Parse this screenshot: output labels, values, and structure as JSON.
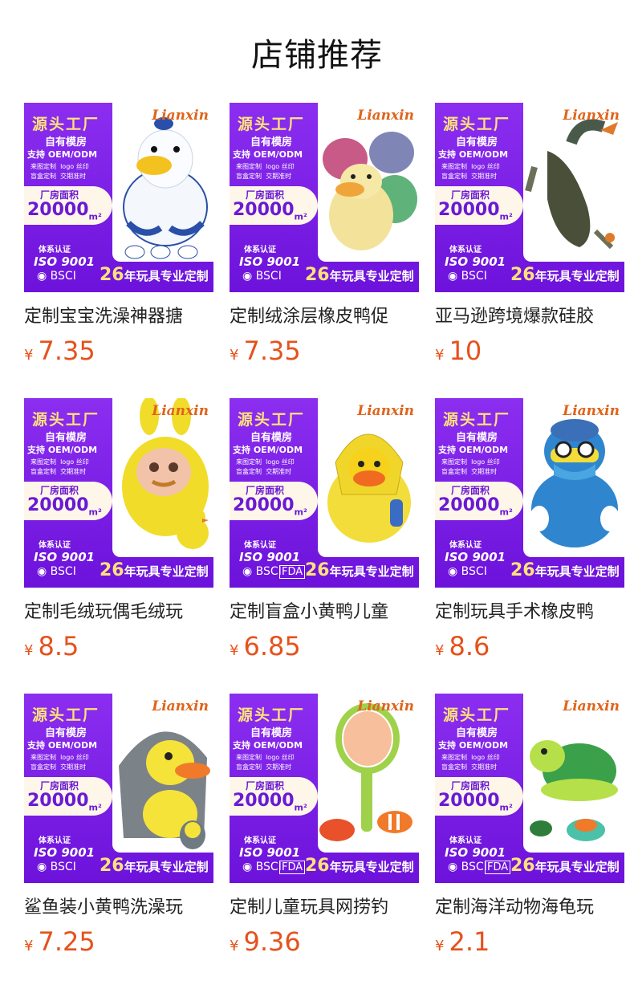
{
  "header": {
    "title": "店铺推荐"
  },
  "banner": {
    "factory": "源头工厂",
    "own_mold": "自有模房",
    "oem": "支持 OEM/ODM",
    "services": "来图定制  logo 丝印\n盲盒定制  交期准时",
    "area_label": "厂房面积",
    "area_value": "20000",
    "area_unit": "m²",
    "cert_label": "体系认证",
    "iso": "ISO 9001",
    "bsci": "BSCI",
    "fda": "FDA",
    "slogan_num": "26",
    "slogan_text": "年玩具专业定制",
    "brand": "Lianxin"
  },
  "currency": "¥",
  "products": [
    {
      "name": "定制宝宝洗澡神器搪",
      "price": "7.35",
      "icon": "white-duck",
      "fda": false
    },
    {
      "name": "定制绒涂层橡皮鸭促",
      "price": "7.35",
      "icon": "colorful-ducks",
      "fda": false
    },
    {
      "name": "亚马逊跨境爆款硅胶",
      "price": "10",
      "icon": "goose-toy",
      "fda": false
    },
    {
      "name": "定制毛绒玩偶毛绒玩",
      "price": "8.5",
      "icon": "bunny-duck",
      "fda": false
    },
    {
      "name": "定制盲盒小黄鸭儿童",
      "price": "6.85",
      "icon": "raincoat-duck",
      "fda": true
    },
    {
      "name": "定制玩具手术橡皮鸭",
      "price": "8.6",
      "icon": "surgeon-duck",
      "fda": false
    },
    {
      "name": "鲨鱼装小黄鸭洗澡玩",
      "price": "7.25",
      "icon": "shark-duck",
      "fda": false
    },
    {
      "name": "定制儿童玩具网捞钓",
      "price": "9.36",
      "icon": "fishing-net-toy",
      "fda": true
    },
    {
      "name": "定制海洋动物海龟玩",
      "price": "2.1",
      "icon": "turtle-toy",
      "fda": true
    }
  ],
  "colors": {
    "price": "#e5521c",
    "banner": "#7a1fe6",
    "accent": "#ffe27a"
  }
}
